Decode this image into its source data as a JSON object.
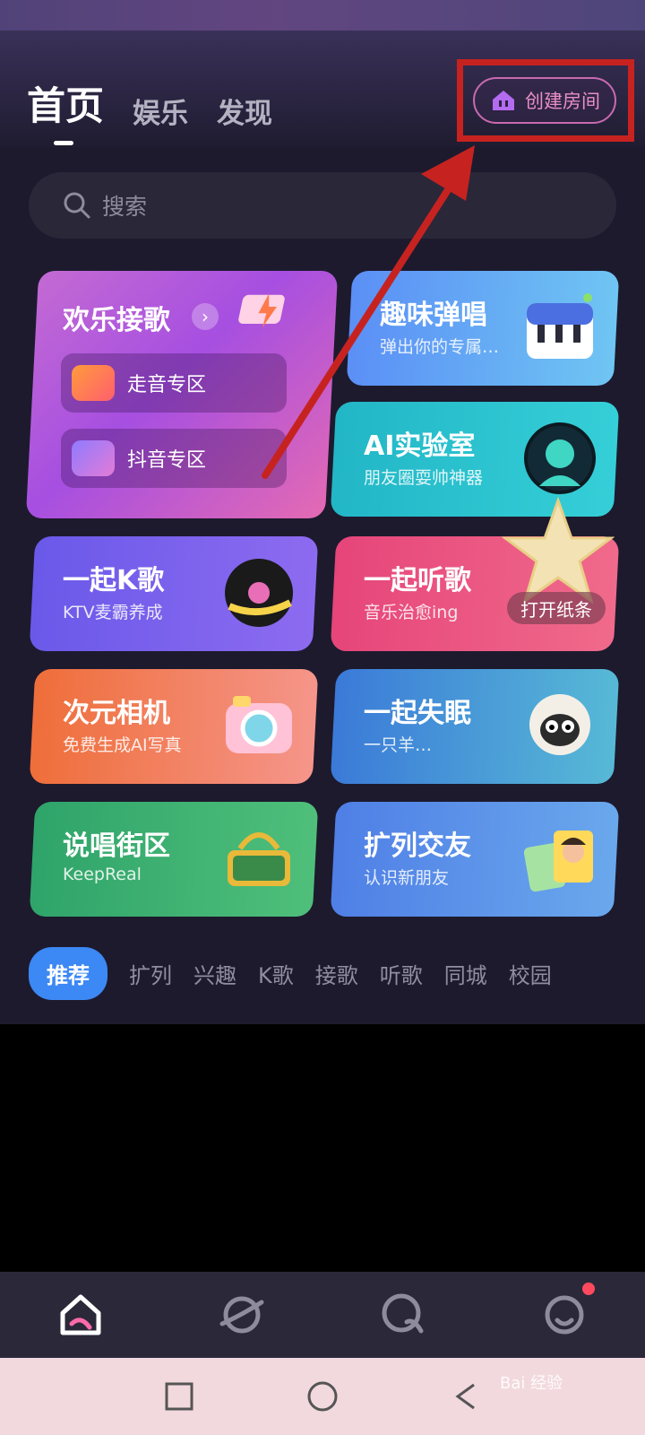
{
  "header": {
    "tabs": [
      {
        "label": "首页",
        "active": true
      },
      {
        "label": "娱乐",
        "active": false
      },
      {
        "label": "发现",
        "active": false
      }
    ],
    "create_room_label": "创建房间"
  },
  "search": {
    "placeholder": "搜索"
  },
  "cards": {
    "big": {
      "title": "欢乐接歌",
      "items": [
        {
          "label": "走音专区"
        },
        {
          "label": "抖音专区"
        }
      ]
    },
    "grid": [
      {
        "title": "趣味弹唱",
        "subtitle": "弹出你的专属…"
      },
      {
        "title": "AI实验室",
        "subtitle": "朋友圈耍帅神器"
      },
      {
        "title": "一起K歌",
        "subtitle": "KTV麦霸养成"
      },
      {
        "title": "一起听歌",
        "subtitle": "音乐治愈ing"
      },
      {
        "title": "次元相机",
        "subtitle": "免费生成AI写真"
      },
      {
        "title": "一起失眠",
        "subtitle": "一只羊…"
      },
      {
        "title": "说唱街区",
        "subtitle": "KeepReal"
      },
      {
        "title": "扩列交友",
        "subtitle": "认识新朋友"
      }
    ]
  },
  "floating_note": {
    "label": "打开纸条"
  },
  "category_tabs": [
    {
      "label": "推荐",
      "active": true
    },
    {
      "label": "扩列"
    },
    {
      "label": "兴趣"
    },
    {
      "label": "K歌"
    },
    {
      "label": "接歌"
    },
    {
      "label": "听歌"
    },
    {
      "label": "同城"
    },
    {
      "label": "校园"
    }
  ],
  "bottom_nav": [
    "home-icon",
    "planet-icon",
    "chat-icon",
    "profile-icon"
  ],
  "system_nav": [
    "recent-apps-icon",
    "home-circle-icon",
    "back-icon"
  ],
  "watermark": "Bai 经验",
  "colors": {
    "accent": "#3c88f4",
    "highlight": "#c62320",
    "background": "#1d1a2e"
  }
}
